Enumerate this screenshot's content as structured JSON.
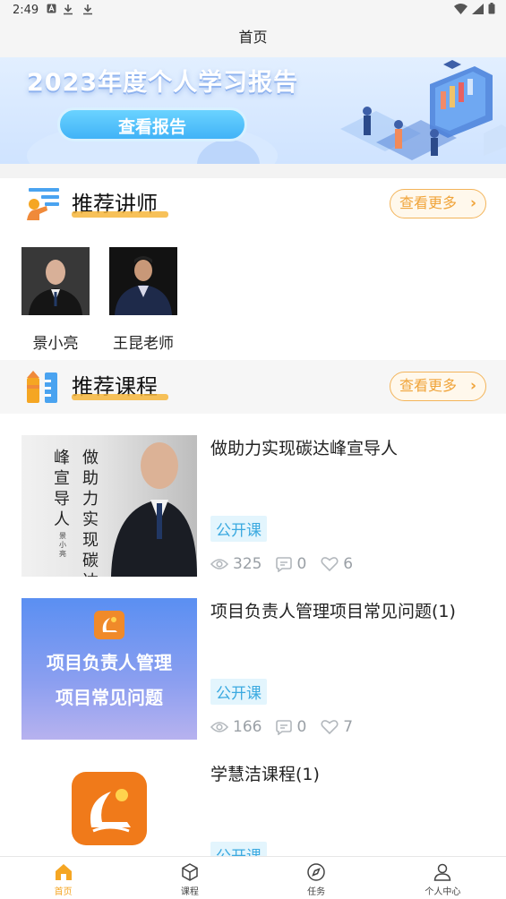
{
  "status_bar": {
    "time": "2:49"
  },
  "header": {
    "title": "首页"
  },
  "banner": {
    "title": "2023年度个人学习报告",
    "button": "查看报告"
  },
  "teachers_section": {
    "title": "推荐讲师",
    "more": "查看更多"
  },
  "teachers": [
    {
      "name": "景小亮"
    },
    {
      "name": "王昆老师"
    }
  ],
  "courses_section": {
    "title": "推荐课程",
    "more": "查看更多"
  },
  "courses": [
    {
      "title": "做助力实现碳达峰宣导人",
      "tag": "公开课",
      "views": "325",
      "comments": "0",
      "likes": "6",
      "thumb_text_left": "峰宣导人",
      "thumb_text_right": "做助力实现碳达",
      "thumb_author": "景小亮"
    },
    {
      "title": "项目负责人管理项目常见问题(1)",
      "tag": "公开课",
      "views": "166",
      "comments": "0",
      "likes": "7",
      "thumb_line1": "项目负责人管理",
      "thumb_line2": "项目常见问题"
    },
    {
      "title": "学慧洁课程(1)",
      "tag": "公开课"
    }
  ],
  "tabbar": {
    "items": [
      {
        "label": "首页"
      },
      {
        "label": "课程"
      },
      {
        "label": "任务"
      },
      {
        "label": "个人中心"
      }
    ],
    "active_color": "#f5a623"
  }
}
